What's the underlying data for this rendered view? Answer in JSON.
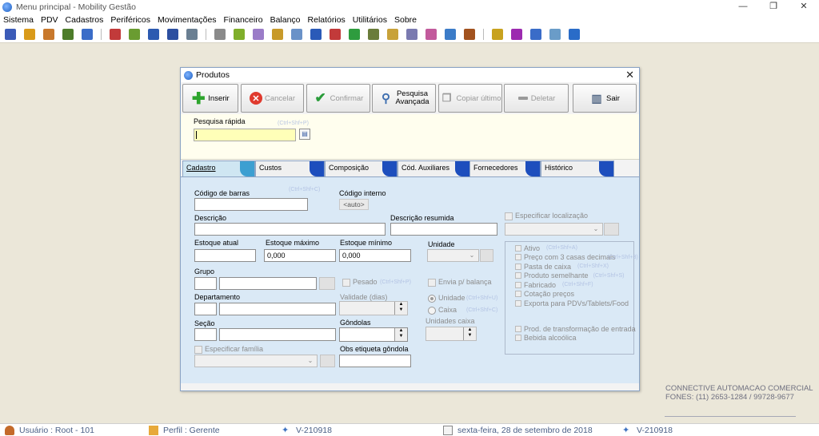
{
  "window": {
    "title": "Menu principal - Mobility Gestão"
  },
  "menu": [
    "Sistema",
    "PDV",
    "Cadastros",
    "Periféricos",
    "Movimentações",
    "Financeiro",
    "Balanço",
    "Relatórios",
    "Utilitários",
    "Sobre"
  ],
  "toolbar_icon_colors": [
    "#3b5bb8",
    "#d99a1a",
    "#c8782c",
    "#4d7c2a",
    "#3a6cc8",
    "#c23a3a",
    "#6a9c31",
    "#2c5ab0",
    "#2c4fa0",
    "#6a7f92",
    "#8a8a8a",
    "#7fae2a",
    "#9b7cc8",
    "#c89a2a",
    "#6a92c8",
    "#2a5ab8",
    "#c23a3a",
    "#2e9c3e",
    "#6a7c3a",
    "#c8a23a",
    "#7a7ab0",
    "#c25a9c",
    "#3c7cc8",
    "#a2521e",
    "#c8a21e",
    "#9c2ab0",
    "#3a6cc8",
    "#6a9cc8",
    "#2a6cc8"
  ],
  "dialog": {
    "title": "Produtos",
    "close_glyph": "✕",
    "buttons": {
      "inserir": "Inserir",
      "cancelar": "Cancelar",
      "confirmar": "Confirmar",
      "pesquisa_1": "Pesquisa",
      "pesquisa_2": "Avançada",
      "copiar": "Copiar último",
      "deletar": "Deletar",
      "sair": "Sair"
    },
    "quick_search": {
      "label": "Pesquisa rápida",
      "hint": "(Ctrl+Shf+P)"
    },
    "tabs": [
      "Cadastro",
      "Custos",
      "Composição",
      "Cód. Auxiliares",
      "Fornecedores",
      "Histórico"
    ],
    "form": {
      "codigo_barras": {
        "label": "Código de barras",
        "hint": "(Ctrl+Shf+C)"
      },
      "codigo_interno": {
        "label": "Código interno",
        "value": "<auto>"
      },
      "descricao": {
        "label": "Descrição"
      },
      "descricao_resumida": {
        "label": "Descrição resumida"
      },
      "especificar_localizacao": "Especificar localização",
      "estoque_atual": {
        "label": "Estoque atual"
      },
      "estoque_maximo": {
        "label": "Estoque máximo",
        "value": "0,000"
      },
      "estoque_minimo": {
        "label": "Estoque mínimo",
        "value": "0,000"
      },
      "unidade": {
        "label": "Unidade"
      },
      "grupo": {
        "label": "Grupo"
      },
      "pesado": {
        "label": "Pesado",
        "hint": "(Ctrl+Shf+P)"
      },
      "envia_balanca": "Envia p/ balança",
      "departamento": {
        "label": "Departamento"
      },
      "validade": {
        "label": "Validade (dias)"
      },
      "radio_unidade": {
        "label": "Unidade",
        "hint": "(Ctrl+Shf+U)"
      },
      "radio_caixa": {
        "label": "Caixa",
        "hint": "(Ctrl+Shf+C)"
      },
      "unidades_caixa": {
        "label": "Unidades caixa"
      },
      "secao": {
        "label": "Seção"
      },
      "gondolas": {
        "label": "Gôndolas"
      },
      "especificar_familia": "Especificar família",
      "obs_etiqueta": {
        "label": "Obs etiqueta gôndola"
      }
    },
    "options": {
      "ativo": {
        "label": "Ativo",
        "hint": "(Ctrl+Shf+A)"
      },
      "tres_casas": {
        "label": "Preço com 3 casas decimais",
        "hint": "(Ctrl+Shf+3)"
      },
      "pasta_caixa": {
        "label": "Pasta de caixa",
        "hint": "(Ctrl+Shf+X)"
      },
      "produto_semelhante": {
        "label": "Produto semelhante",
        "hint": "(Ctrl+Shf+S)"
      },
      "fabricado": {
        "label": "Fabricado",
        "hint": "(Ctrl+Shf+F)"
      },
      "cotacao": {
        "label": "Cotação preços"
      },
      "exporta": {
        "label": "Exporta para PDVs/Tablets/Food"
      },
      "prod_transformacao": {
        "label": "Prod. de transformação de entrada"
      },
      "bebida": {
        "label": "Bebida alcoólica"
      }
    }
  },
  "company": {
    "line1": "CONNECTIVE AUTOMACAO COMERCIAL",
    "line2": "FONES: (11) 2653-1284 / 99728-9677"
  },
  "status": {
    "usuario": "Usuário : Root - 101",
    "perfil": "Perfil : Gerente",
    "versao1": "V-210918",
    "data": "sexta-feira, 28 de setembro de 2018",
    "versao2": "V-210918"
  }
}
